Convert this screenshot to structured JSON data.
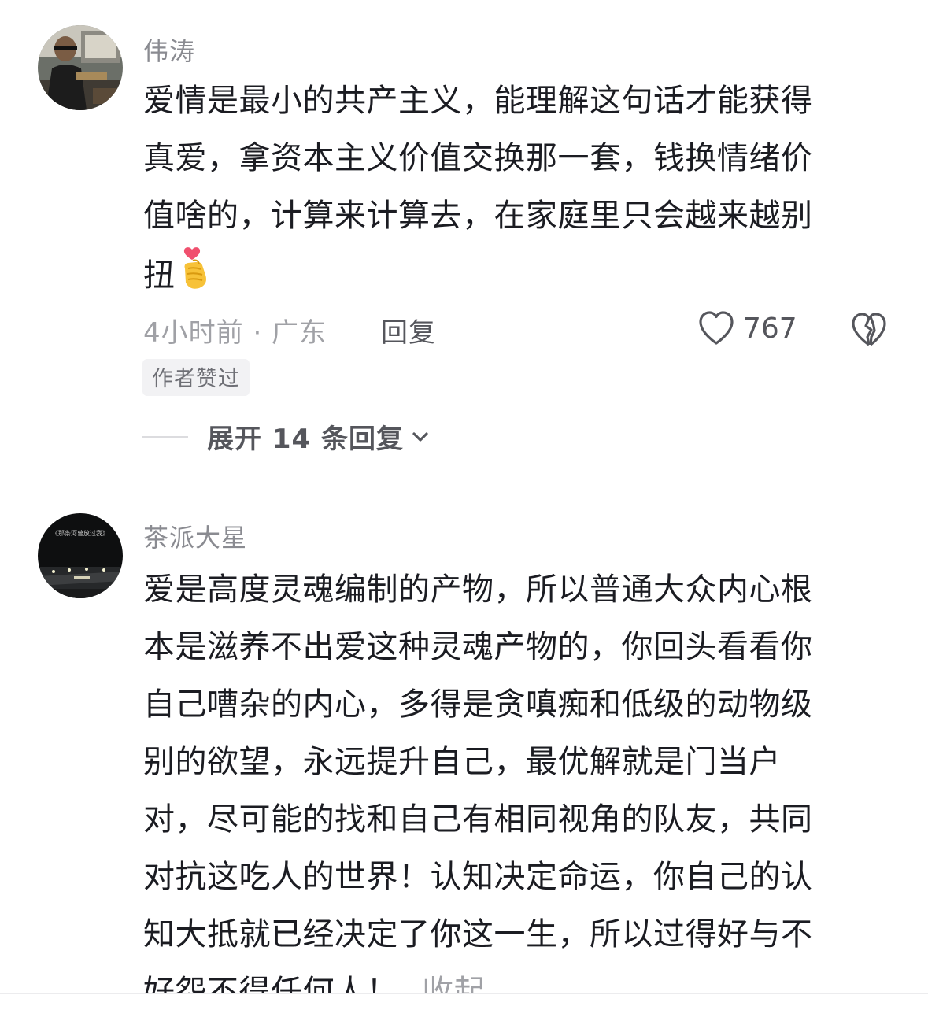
{
  "comments": [
    {
      "username": "伟涛",
      "lines": [
        "爱情是最小的共产主义，能理解这句话才能获得",
        "真爱，拿资本主义价值交换那一套，钱换情绪价",
        "值啥的，计算来计算去，在家庭里只会越来越别",
        "扭"
      ],
      "emoji": "finger-heart-icon",
      "time_location": "4小时前 · 广东",
      "reply_label": "回复",
      "like_count": "767",
      "author_badge": "作者赞过",
      "expand_label": "展开 14 条回复"
    },
    {
      "username": "茶派大星",
      "avatar_caption": "《那条河曾放过我》",
      "lines": [
        "爱是高度灵魂编制的产物，所以普通大众内心根",
        "本是滋养不出爱这种灵魂产物的，你回头看看你",
        "自己嘈杂的内心，多得是贪嗔痴和低级的动物级",
        "别的欲望，永远提升自己，最优解就是门当户",
        "对，尽可能的找和自己有相同视角的队友，共同",
        "对抗这吃人的世界！认知决定命运，你自己的认",
        "知大抵就已经决定了你这一生，所以过得好与不",
        "好怨不得任何人！"
      ],
      "collapse_label": "收起"
    }
  ],
  "colors": {
    "text": "#1b1c22",
    "secondary": "#8a8b91",
    "meta": "#a0a1a6",
    "action": "#55565c",
    "badge_bg": "#f2f2f4"
  }
}
